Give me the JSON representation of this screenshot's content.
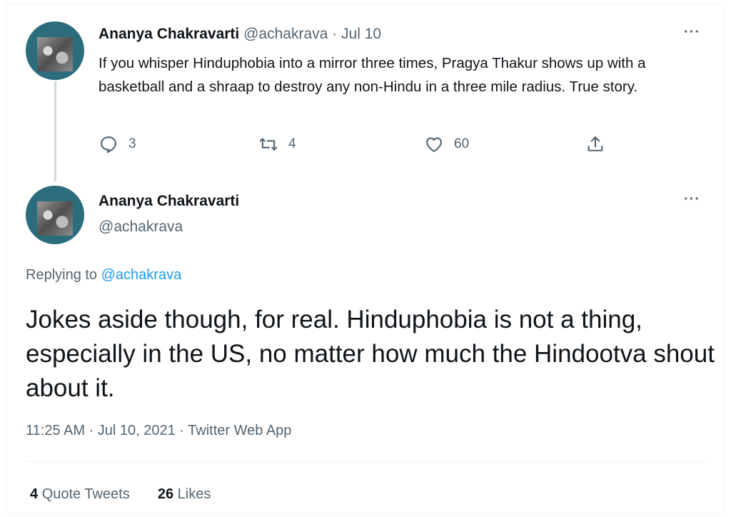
{
  "thread": {
    "first_tweet": {
      "author_name": "Ananya Chakravarti",
      "handle": "@achakrava",
      "separator": "·",
      "date": "Jul 10",
      "text": "If you whisper Hinduphobia into a mirror three times, Pragya Thakur shows up with a basketball and a shraap to destroy any non-Hindu in a three mile radius. True story.",
      "reply_count": "3",
      "retweet_count": "4",
      "like_count": "60",
      "more_label": "···"
    },
    "main_tweet": {
      "author_name": "Ananya Chakravarti",
      "handle": "@achakrava",
      "more_label": "···",
      "replying_prefix": "Replying to",
      "replying_to": "@achakrava",
      "text": "Jokes aside though, for real. Hinduphobia is not a thing, especially in the US, no matter how much the Hindootva shout about it.",
      "timestamp": "11:25 AM · Jul 10, 2021 · Twitter Web App",
      "quote_tweets_count": "4",
      "quote_tweets_label": "Quote Tweets",
      "likes_count": "26",
      "likes_label": "Likes"
    }
  },
  "colors": {
    "link": "#1d9bf0",
    "muted": "#536471",
    "text": "#0f1419",
    "avatar_bg": "#2b6d7c"
  },
  "icons": [
    "reply-icon",
    "retweet-icon",
    "like-icon",
    "share-icon",
    "more-icon"
  ]
}
